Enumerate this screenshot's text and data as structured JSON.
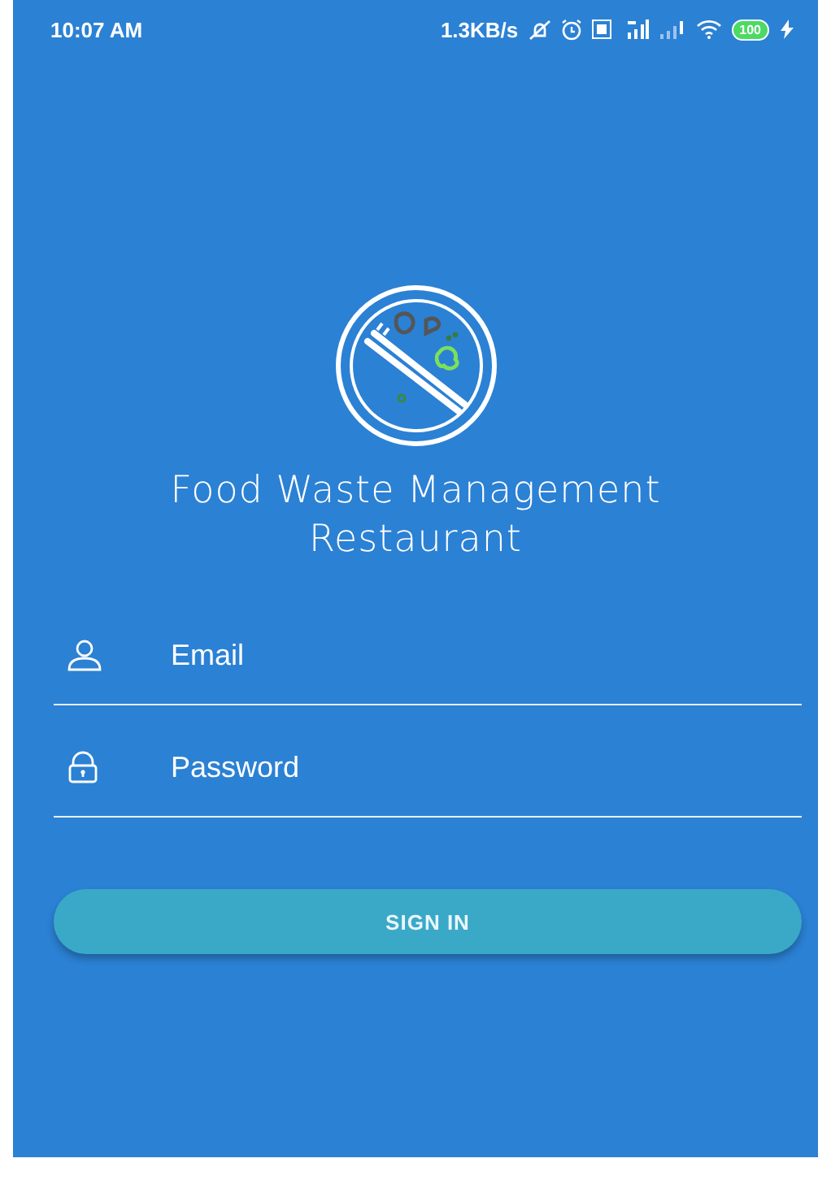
{
  "status_bar": {
    "time": "10:07 AM",
    "speed": "1.3KB/s",
    "battery": "100"
  },
  "app": {
    "title_lines": [
      "Food Waste Management",
      "Restaurant"
    ]
  },
  "fields": [
    {
      "kind": "email",
      "placeholder": "Email"
    },
    {
      "kind": "password",
      "placeholder": "Password"
    }
  ],
  "button": {
    "label": "SIGN IN"
  }
}
